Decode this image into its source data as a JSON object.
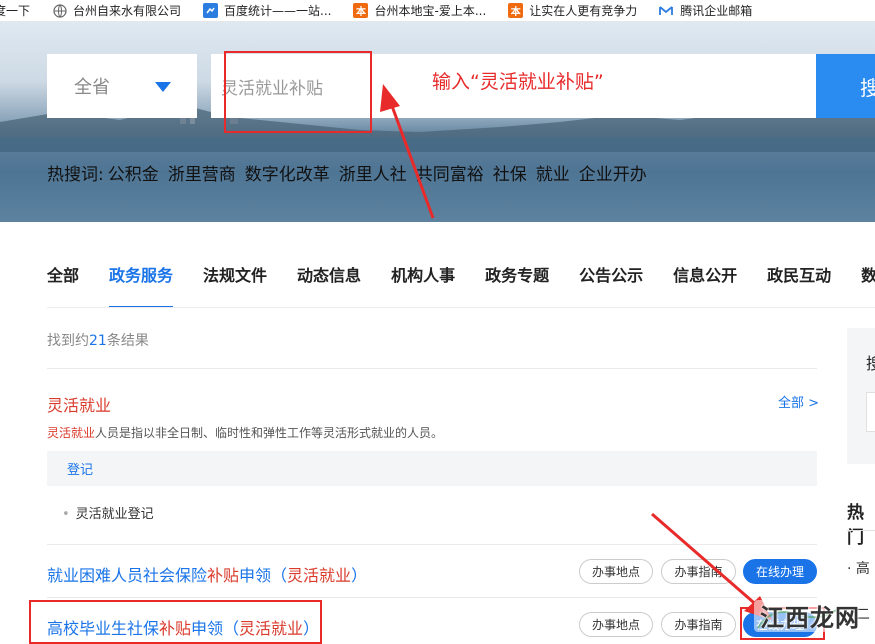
{
  "bookmarks": [
    {
      "label": "度一下",
      "icon": "none"
    },
    {
      "label": "台州自来水有限公司",
      "icon": "globe-icon"
    },
    {
      "label": "百度统计——一站...",
      "icon": "baidu-tongji-icon"
    },
    {
      "label": "台州本地宝-爱上本...",
      "icon": "bendibao-icon"
    },
    {
      "label": "让实在人更有竞争力",
      "icon": "bendibao-icon"
    },
    {
      "label": "腾讯企业邮箱",
      "icon": "tencent-mail-icon"
    }
  ],
  "search": {
    "region": "全省",
    "placeholder": "灵活就业补贴",
    "button_label": "搜"
  },
  "annotation": {
    "instruction": "输入“灵活就业补贴”"
  },
  "hot_search": {
    "label": "热搜词:",
    "terms": [
      "公积金",
      "浙里营商",
      "数字化改革",
      "浙里人社",
      "共同富裕",
      "社保",
      "就业",
      "企业开办"
    ]
  },
  "tabs": [
    {
      "label": "全部",
      "active": false
    },
    {
      "label": "政务服务",
      "active": true
    },
    {
      "label": "法规文件",
      "active": false
    },
    {
      "label": "动态信息",
      "active": false
    },
    {
      "label": "机构人事",
      "active": false
    },
    {
      "label": "政务专题",
      "active": false
    },
    {
      "label": "公告公示",
      "active": false
    },
    {
      "label": "信息公开",
      "active": false
    },
    {
      "label": "政民互动",
      "active": false
    },
    {
      "label": "数",
      "active": false
    }
  ],
  "results": {
    "count_prefix": "找到约",
    "count": "21",
    "count_suffix": "条结果",
    "topic": {
      "title": "灵活就业",
      "all_link": "全部 >",
      "desc_highlight": "灵活就业",
      "desc_rest": "人员是指以非全日制、临时性和弹性工作等灵活形式就业的人员。",
      "category": "登记",
      "item": "灵活就业登记"
    },
    "items": [
      {
        "title_pre": "就业困难人员社会保险",
        "title_hl": "补贴",
        "title_mid": "申领（",
        "title_hl2": "灵活就业",
        "title_post": "）",
        "btn_location": "办事地点",
        "btn_guide": "办事指南",
        "btn_online": "在线办理"
      },
      {
        "title_pre": "高校毕业生社保",
        "title_hl": "补贴",
        "title_mid": "申领（",
        "title_hl2": "灵活就业",
        "title_post": "）",
        "btn_location": "办事地点",
        "btn_guide": "办事指南",
        "btn_online": "在线办理"
      }
    ]
  },
  "sidebar": {
    "search_char": "搜",
    "hot_title": "热门",
    "rows": [
      "高",
      "二"
    ]
  },
  "watermark": "江西龙网",
  "colors": {
    "accent": "#1a74e8",
    "highlight": "#d93a2b",
    "annotation": "#e82a2a"
  }
}
